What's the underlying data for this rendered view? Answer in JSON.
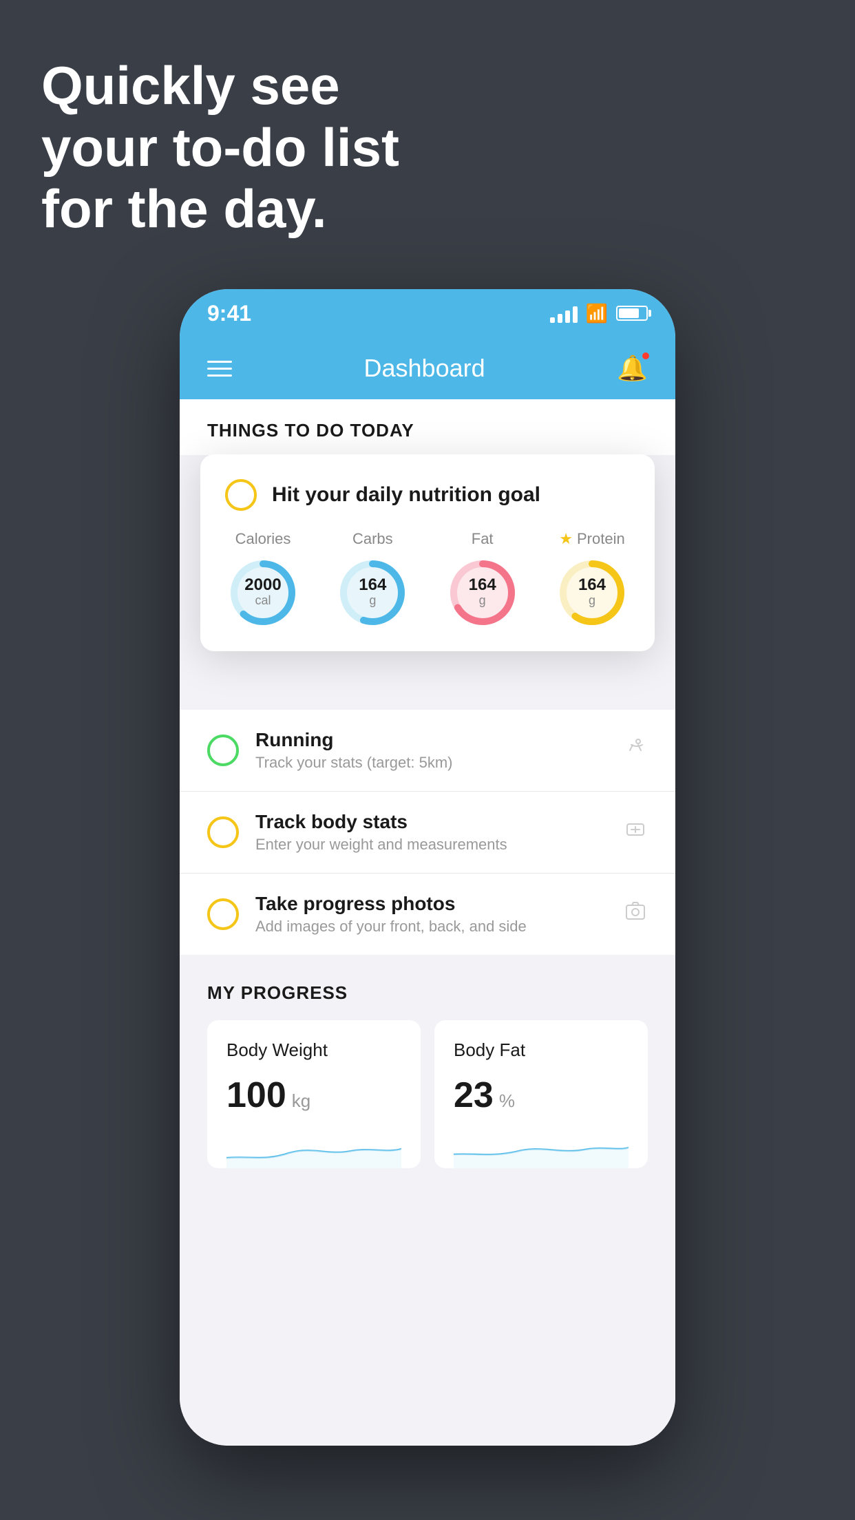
{
  "headline": {
    "line1": "Quickly see",
    "line2": "your to-do list",
    "line3": "for the day."
  },
  "status_bar": {
    "time": "9:41",
    "signal_bars": [
      8,
      12,
      17,
      22
    ],
    "battery_percent": 75
  },
  "header": {
    "title": "Dashboard"
  },
  "things_section": {
    "title": "THINGS TO DO TODAY"
  },
  "floating_card": {
    "task_label": "Hit your daily nutrition goal",
    "nutrition": [
      {
        "label": "Calories",
        "value": "2000",
        "unit": "cal",
        "color": "#4db8e8",
        "bg": "#e8f6fc",
        "percent": 65
      },
      {
        "label": "Carbs",
        "value": "164",
        "unit": "g",
        "color": "#4db8e8",
        "bg": "#e8f6fc",
        "percent": 55
      },
      {
        "label": "Fat",
        "value": "164",
        "unit": "g",
        "color": "#f4758a",
        "bg": "#fde8ec",
        "percent": 70
      },
      {
        "label": "Protein",
        "value": "164",
        "unit": "g",
        "color": "#f5c518",
        "bg": "#fef9e6",
        "percent": 60,
        "star": true
      }
    ]
  },
  "tasks": [
    {
      "name": "Running",
      "sub": "Track your stats (target: 5km)",
      "circle_color": "green",
      "icon": "🏃"
    },
    {
      "name": "Track body stats",
      "sub": "Enter your weight and measurements",
      "circle_color": "yellow",
      "icon": "⚖️"
    },
    {
      "name": "Take progress photos",
      "sub": "Add images of your front, back, and side",
      "circle_color": "yellow",
      "icon": "🖼️"
    }
  ],
  "progress": {
    "title": "MY PROGRESS",
    "cards": [
      {
        "title": "Body Weight",
        "value": "100",
        "unit": "kg"
      },
      {
        "title": "Body Fat",
        "value": "23",
        "unit": "%"
      }
    ]
  }
}
